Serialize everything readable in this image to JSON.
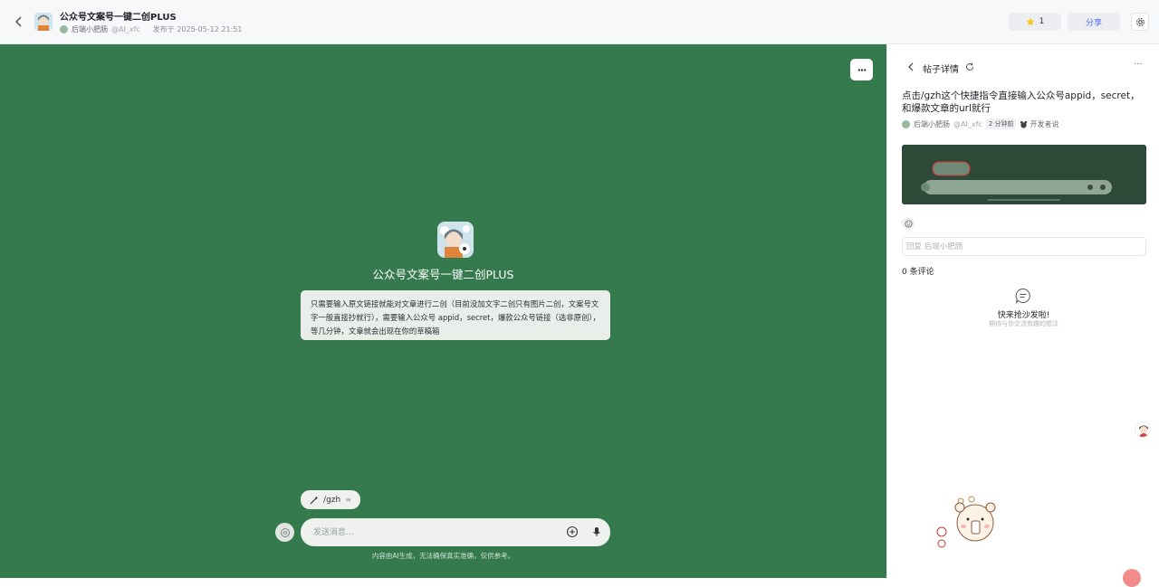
{
  "header": {
    "title": "公众号文案号一键二创PLUS",
    "author": "后端小肥肠",
    "handle": "@AI_xfc",
    "published": "发布于 2025-05-12 21:51",
    "star_count": "1",
    "share_label": "分享"
  },
  "chat": {
    "bot_name": "公众号文案号一键二创PLUS",
    "intro": "只需要输入原文链接就能对文章进行二创（目前没加文字二创只有图片二创，文案号文字一般直接抄就行），需要输入公众号 appid，secret，爆款公众号链接（选非原创），等几分钟，文章就会出现在你的草稿箱",
    "command_chip": "/gzh",
    "input_placeholder": "发送消息...",
    "disclaimer": "内容由AI生成，无法确保真实准确，仅供参考。"
  },
  "panel": {
    "title": "帖子详情",
    "post_text": "点击/gzh这个快捷指令直接输入公众号appid，secret，和爆款文章的url就行",
    "author": "后端小肥肠",
    "handle": "@AI_xfc",
    "time_badge": "2 分钟前",
    "dev_tag": "开发者说",
    "reply_placeholder": "回复 后端小肥肠",
    "comment_count": "0 条评论",
    "empty_title": "快来抢沙发啦!",
    "empty_subtitle": "期待与你交流有趣的想法"
  },
  "colors": {
    "chat_background": "#357a4d",
    "share_text": "#4a6cf7",
    "star": "#f5c518"
  },
  "icons": [
    "back-icon",
    "star-icon",
    "settings-icon",
    "more-icon",
    "voice-icon",
    "plus-circle-icon",
    "mic-icon",
    "refresh-icon",
    "emoji-icon",
    "comment-empty-icon"
  ]
}
